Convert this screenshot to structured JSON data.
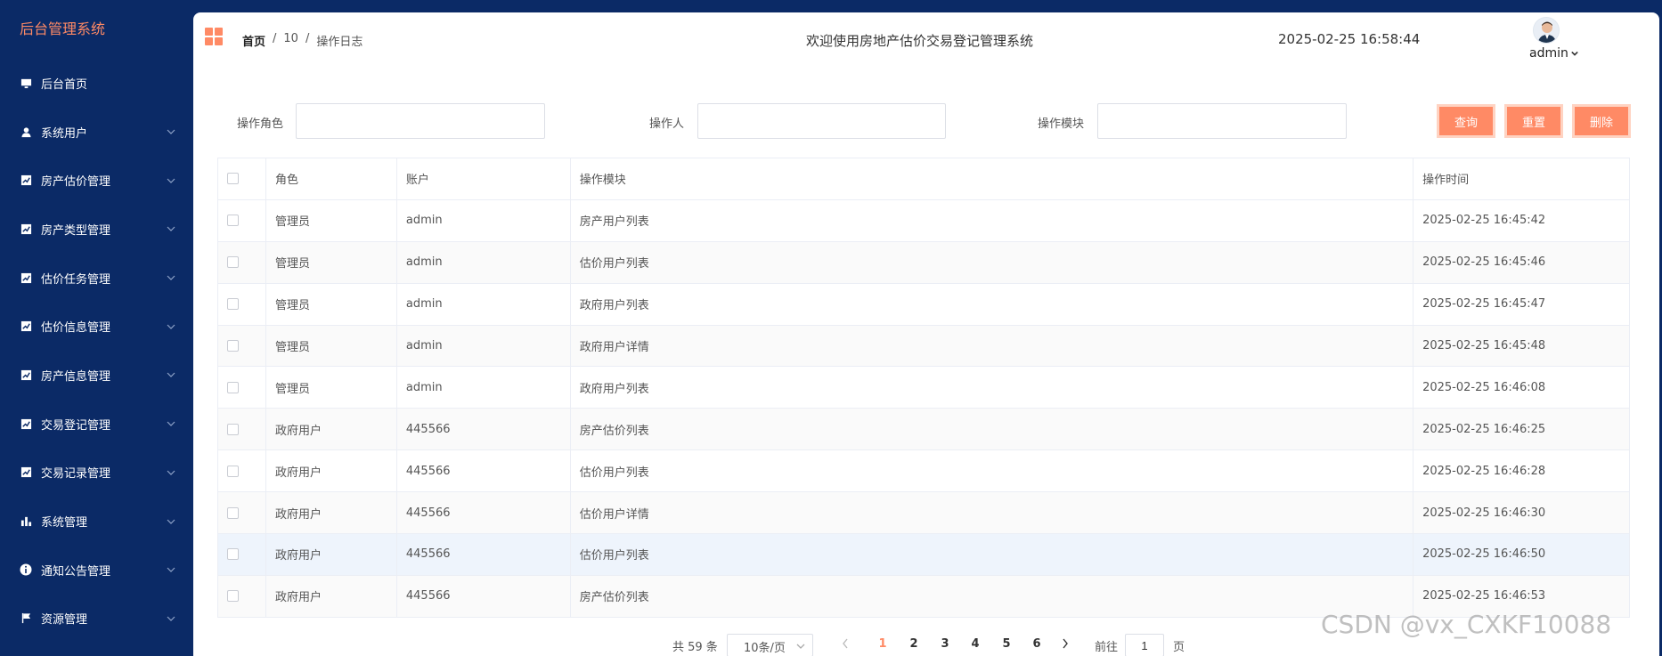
{
  "sidebar": {
    "brand": "后台管理系统",
    "items": [
      {
        "label": "后台首页",
        "icon": "monitor-icon",
        "has_children": false
      },
      {
        "label": "系统用户",
        "icon": "user-icon",
        "has_children": true
      },
      {
        "label": "房产估价管理",
        "icon": "chart-icon",
        "has_children": true
      },
      {
        "label": "房产类型管理",
        "icon": "chart-icon",
        "has_children": true
      },
      {
        "label": "估价任务管理",
        "icon": "chart-icon",
        "has_children": true
      },
      {
        "label": "估价信息管理",
        "icon": "chart-icon",
        "has_children": true
      },
      {
        "label": "房产信息管理",
        "icon": "chart-icon",
        "has_children": true
      },
      {
        "label": "交易登记管理",
        "icon": "chart-icon",
        "has_children": true
      },
      {
        "label": "交易记录管理",
        "icon": "chart-icon",
        "has_children": true
      },
      {
        "label": "系统管理",
        "icon": "bar-chart-icon",
        "has_children": true
      },
      {
        "label": "通知公告管理",
        "icon": "info-icon",
        "has_children": true
      },
      {
        "label": "资源管理",
        "icon": "flag-icon",
        "has_children": true
      }
    ]
  },
  "header": {
    "breadcrumb": {
      "home": "首页",
      "sep": "/",
      "level2": "10",
      "current": "操作日志"
    },
    "welcome": "欢迎使用房地产估价交易登记管理系统",
    "datetime": "2025-02-25 16:58:44",
    "username": "admin"
  },
  "search": {
    "role_label": "操作角色",
    "operator_label": "操作人",
    "module_label": "操作模块",
    "role_value": "",
    "operator_value": "",
    "module_value": "",
    "query_button": "查询",
    "reset_button": "重置",
    "delete_button": "删除"
  },
  "table": {
    "columns": [
      "角色",
      "账户",
      "操作模块",
      "操作时间"
    ],
    "rows": [
      [
        "管理员",
        "admin",
        "房产用户列表",
        "2025-02-25 16:45:42"
      ],
      [
        "管理员",
        "admin",
        "估价用户列表",
        "2025-02-25 16:45:46"
      ],
      [
        "管理员",
        "admin",
        "政府用户列表",
        "2025-02-25 16:45:47"
      ],
      [
        "管理员",
        "admin",
        "政府用户详情",
        "2025-02-25 16:45:48"
      ],
      [
        "管理员",
        "admin",
        "政府用户列表",
        "2025-02-25 16:46:08"
      ],
      [
        "政府用户",
        "445566",
        "房产估价列表",
        "2025-02-25 16:46:25"
      ],
      [
        "政府用户",
        "445566",
        "估价用户列表",
        "2025-02-25 16:46:28"
      ],
      [
        "政府用户",
        "445566",
        "估价用户详情",
        "2025-02-25 16:46:30"
      ],
      [
        "政府用户",
        "445566",
        "估价用户列表",
        "2025-02-25 16:46:50"
      ],
      [
        "政府用户",
        "445566",
        "房产估价列表",
        "2025-02-25 16:46:53"
      ]
    ]
  },
  "pagination": {
    "total": "共 59 条",
    "page_size": "10条/页",
    "pages": [
      "1",
      "2",
      "3",
      "4",
      "5",
      "6"
    ],
    "current_page": "1",
    "goto_label": "前往",
    "goto_value": "1",
    "goto_unit": "页"
  },
  "watermark": "CSDN @vx_CXKF10088",
  "colors": {
    "sidebar_bg": "#0b2a66",
    "accent": "#ff8a65",
    "brand_text": "#ff8a65"
  }
}
